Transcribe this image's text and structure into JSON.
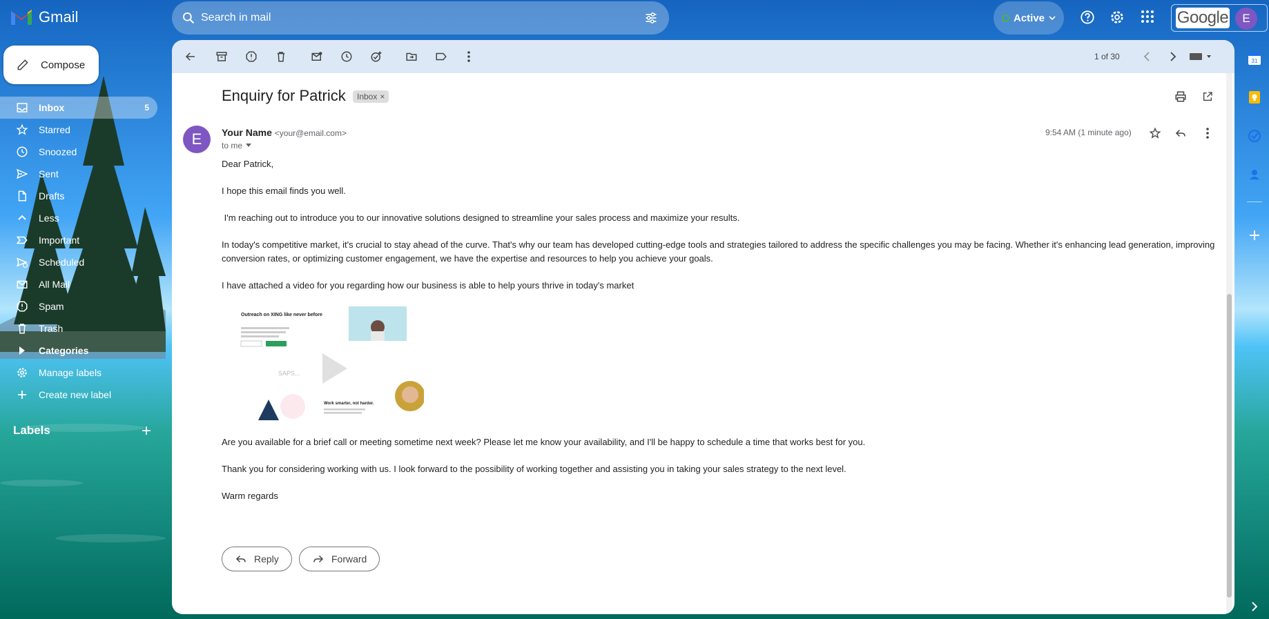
{
  "app": {
    "name": "Gmail"
  },
  "search": {
    "placeholder": "Search in mail"
  },
  "status": {
    "label": "Active",
    "color": "#4caf50"
  },
  "google": {
    "word": "Google",
    "avatar_letter": "E"
  },
  "compose": {
    "label": "Compose"
  },
  "sidebar": {
    "items": [
      {
        "label": "Inbox",
        "count": "5",
        "icon": "inbox-icon",
        "selected": true
      },
      {
        "label": "Starred",
        "icon": "star-icon"
      },
      {
        "label": "Snoozed",
        "icon": "clock-icon"
      },
      {
        "label": "Sent",
        "icon": "send-icon"
      },
      {
        "label": "Drafts",
        "icon": "draft-icon"
      },
      {
        "label": "Less",
        "icon": "chevron-up-icon"
      },
      {
        "label": "Important",
        "icon": "important-icon"
      },
      {
        "label": "Scheduled",
        "icon": "scheduled-icon"
      },
      {
        "label": "All Mail",
        "icon": "all-mail-icon"
      },
      {
        "label": "Spam",
        "icon": "spam-icon"
      },
      {
        "label": "Trash",
        "icon": "trash-icon"
      },
      {
        "label": "Categories",
        "icon": "caret-right-icon"
      },
      {
        "label": "Manage labels",
        "icon": "gear-icon"
      },
      {
        "label": "Create new label",
        "icon": "plus-icon"
      }
    ],
    "labels_heading": "Labels"
  },
  "toolbar": {
    "page_count": "1 of 30"
  },
  "email": {
    "subject": "Enquiry for Patrick",
    "chip": "Inbox",
    "sender_name": "Your Name",
    "sender_email": "<your@email.com>",
    "to": "to me",
    "avatar_letter": "E",
    "time": "9:54 AM (1 minute ago)",
    "greeting": "Dear Patrick,",
    "p1": "I hope this email finds you well.",
    "p2": " I'm reaching out to introduce you to our innovative solutions designed to streamline your sales process and maximize your results.",
    "p3": "In today's competitive market, it's crucial to stay ahead of the curve. That's why our team has developed cutting-edge tools and strategies tailored to address the specific challenges you may be facing. Whether it's enhancing lead generation, improving conversion rates, or optimizing customer engagement, we have the expertise and resources to help you achieve your goals.",
    "p4": "I have attached a video for you regarding how our business is able to help yours thrive in today's market",
    "video": {
      "heading": "Outreach on XING like never before",
      "subheading": "Work smarter, not harder."
    },
    "p5": "Are you available for a brief call or meeting sometime next week? Please let me know your availability, and I'll be happy to schedule a time that works best for you.",
    "p6": "Thank you for considering working with us. I look forward to the possibility of working together and assisting you in taking your sales strategy to the next level.",
    "signoff": "Warm regards"
  },
  "actions": {
    "reply": "Reply",
    "forward": "Forward"
  },
  "rail": {
    "calendar_day": "31"
  },
  "colors": {
    "accent": "#0b57d0",
    "avatar": "#7e57c2",
    "toolbar_bg": "#dce8f5"
  }
}
